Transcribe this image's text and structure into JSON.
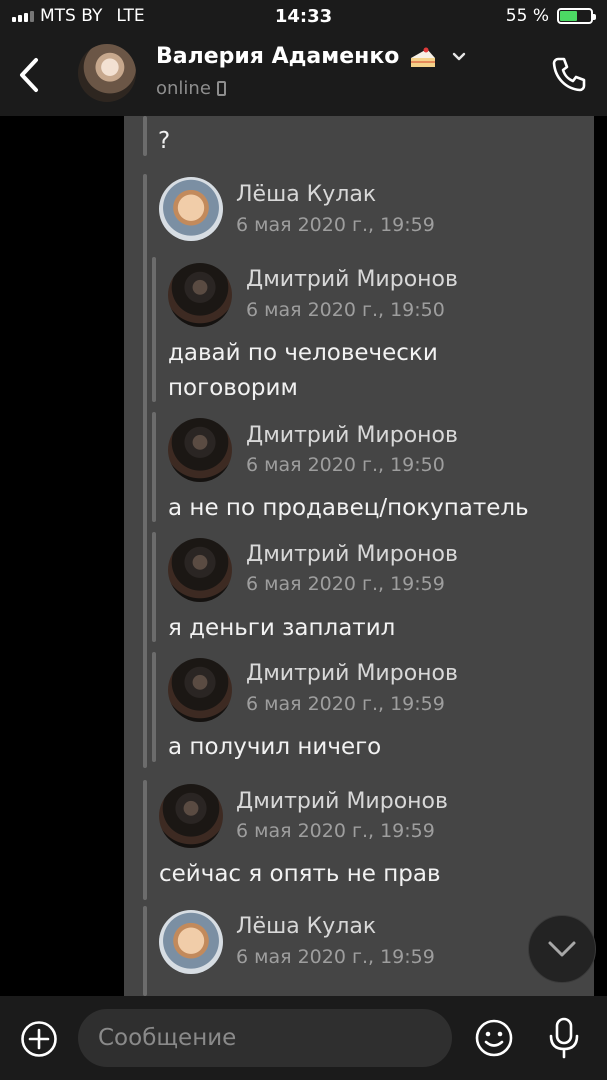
{
  "status_bar": {
    "carrier": "MTS BY",
    "network": "LTE",
    "time": "14:33",
    "battery": "55 %",
    "battery_level": 0.55,
    "battery_color": "#4cd964"
  },
  "header": {
    "name": "Валерия Адаменко",
    "status": "online",
    "icons": [
      "back-icon",
      "avatar",
      "cake-icon",
      "chevron-down-icon",
      "phone-icon"
    ]
  },
  "messages": {
    "top_fragment": "?",
    "items": [
      {
        "sender": "Лёша Кулак",
        "date": "6 мая 2020 г., 19:59",
        "text": ""
      },
      {
        "sender": "Дмитрий Миронов",
        "date": "6 мая 2020 г., 19:50",
        "text_lines": [
          "давай по человечески",
          "поговорим"
        ]
      },
      {
        "sender": "Дмитрий Миронов",
        "date": "6 мая 2020 г., 19:50",
        "text": "а не по продавец/покупатель"
      },
      {
        "sender": "Дмитрий Миронов",
        "date": "6 мая 2020 г., 19:59",
        "text": "я деньги заплатил"
      },
      {
        "sender": "Дмитрий Миронов",
        "date": "6 мая 2020 г., 19:59",
        "text": "а получил ничего"
      },
      {
        "sender": "Дмитрий Миронов",
        "date": "6 мая 2020 г., 19:59",
        "text": "сейчас я опять не прав"
      },
      {
        "sender": "Лёша Кулак",
        "date": "6 мая 2020 г., 19:59",
        "text": ""
      }
    ]
  },
  "composer": {
    "placeholder": "Сообщение",
    "icons": [
      "plus-icon",
      "emoji-icon",
      "microphone-icon"
    ]
  }
}
